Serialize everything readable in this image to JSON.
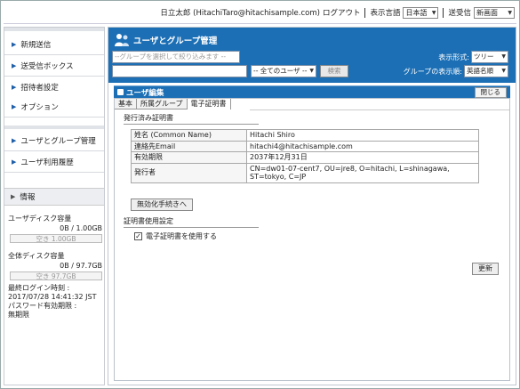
{
  "header": {
    "user": "日立太郎 (HitachiTaro@hitachisample.com)",
    "logout": "ログアウト",
    "lang_label": "表示言語",
    "lang_value": "日本語",
    "recv_label": "送受信",
    "recv_value": "新画面"
  },
  "sidebar": {
    "items": [
      {
        "label": "新規送信"
      },
      {
        "label": "送受信ボックス"
      },
      {
        "label": "招待者設定"
      },
      {
        "label": "オプション"
      },
      {
        "label": "ユーザとグループ管理"
      },
      {
        "label": "ユーザ利用履歴"
      }
    ],
    "info": {
      "title": "情報",
      "user_disk_label": "ユーザディスク容量",
      "user_disk_value": "0B / 1.00GB",
      "user_disk_free": "空き 1.00GB",
      "user_disk_used": 0,
      "total_disk_label": "全体ディスク容量",
      "total_disk_value": "0B / 97.7GB",
      "total_disk_free": "空き 97.7GB",
      "total_disk_used": 0,
      "last_login_label": "最終ログイン時刻 :",
      "last_login_value": "2017/07/28 14:41:32 JST",
      "pw_label": "パスワード有効期限 :",
      "pw_value": "無期限"
    }
  },
  "main": {
    "title": "ユーザとグループ管理",
    "group_filter_placeholder": "--グループを選択して絞り込みます --",
    "user_filter": "-- 全てのユーザ --",
    "search_button": "検索",
    "display_format_label": "表示形式:",
    "display_format_value": "ツリー",
    "group_order_label": "グループの表示順:",
    "group_order_value": "英語名順"
  },
  "editor": {
    "title": "ユーザ編集",
    "close_button": "閉じる",
    "tabs": [
      {
        "label": "基本"
      },
      {
        "label": "所属グループ"
      },
      {
        "label": "電子証明書"
      }
    ],
    "issued_title": "発行済み証明書",
    "rows": [
      {
        "key": "姓名 (Common Name)",
        "value": "Hitachi Shiro"
      },
      {
        "key": "連絡先Email",
        "value": "hitachi4@hitachisample.com"
      },
      {
        "key": "有効期限",
        "value": "2037年12月31日"
      },
      {
        "key": "発行者",
        "value": "CN=dw01-07-cent7, OU=jre8, O=hitachi, L=shinagawa, ST=tokyo, C=JP"
      }
    ],
    "invalidate_button": "無効化手続きへ",
    "usage_title": "証明書使用設定",
    "use_cert_label": "電子証明書を使用する",
    "use_cert_checked": true,
    "update_button": "更新"
  }
}
